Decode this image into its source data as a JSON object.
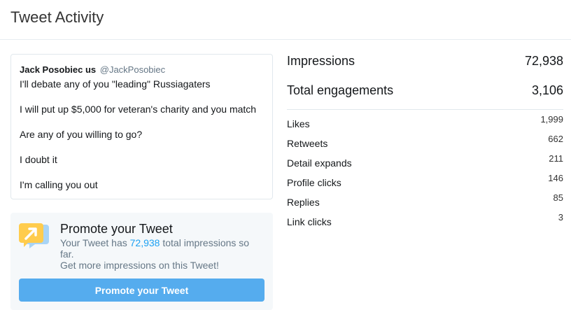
{
  "header": {
    "title": "Tweet Activity"
  },
  "tweet": {
    "name": "Jack Posobiec",
    "flag": "us",
    "handle": "@JackPosobiec",
    "lines": [
      "I'll debate any of you \"leading\" Russiagaters",
      "I will put up $5,000 for veteran's charity and you match",
      "Are any of you willing to go?",
      "I doubt it",
      "I'm calling you out"
    ]
  },
  "promote": {
    "icon": "promote-megaphone-icon",
    "title": "Promote your Tweet",
    "text_prefix": "Your Tweet has",
    "impressions": "72,938",
    "text_suffix": "total impressions so far.",
    "text2": "Get more impressions on this Tweet!",
    "button_label": "Promote your Tweet"
  },
  "stats": {
    "impressions": {
      "label": "Impressions",
      "value": "72,938"
    },
    "engagements": {
      "label": "Total engagements",
      "value": "3,106"
    },
    "rows": [
      {
        "label": "Likes",
        "value": "1,999"
      },
      {
        "label": "Retweets",
        "value": "662"
      },
      {
        "label": "Detail expands",
        "value": "211"
      },
      {
        "label": "Profile clicks",
        "value": "146"
      },
      {
        "label": "Replies",
        "value": "85"
      },
      {
        "label": "Link clicks",
        "value": "3"
      }
    ]
  },
  "colors": {
    "accent": "#1da1f2",
    "button": "#55acee",
    "muted": "#657786",
    "panel": "#f5f8fa",
    "icon": "#ffad1f"
  }
}
